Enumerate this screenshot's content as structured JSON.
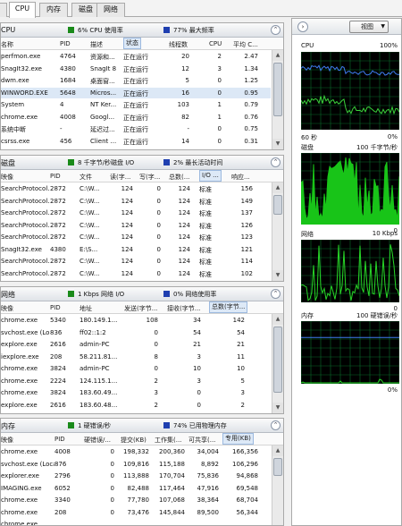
{
  "tabs": [
    "CPU",
    "内存",
    "磁盘",
    "网络"
  ],
  "cpu_panel": {
    "title": "CPU",
    "stat1": "6% CPU 使用率",
    "stat2": "77% 最大频率",
    "columns": [
      "名称",
      "PID",
      "描述",
      "状态",
      "线程数",
      "CPU",
      "平均 C..."
    ],
    "rows": [
      [
        "perfmon.exe",
        "4764",
        "资源和...",
        "正在运行",
        "20",
        "2",
        "2.47"
      ],
      [
        "SnagIt32.exe",
        "4380",
        "SnagIt 8",
        "正在运行",
        "12",
        "3",
        "1.34"
      ],
      [
        "dwm.exe",
        "1684",
        "桌面窗...",
        "正在运行",
        "5",
        "0",
        "1.25"
      ],
      [
        "WINWORD.EXE",
        "5648",
        "Micros...",
        "正在运行",
        "16",
        "0",
        "0.95"
      ],
      [
        "System",
        "4",
        "NT Ker...",
        "正在运行",
        "103",
        "1",
        "0.79"
      ],
      [
        "chrome.exe",
        "4008",
        "Googl...",
        "正在运行",
        "82",
        "1",
        "0.76"
      ],
      [
        "系统中断",
        "-",
        "延迟过...",
        "正在运行",
        "-",
        "0",
        "0.75"
      ],
      [
        "csrss.exe",
        "456",
        "Client ...",
        "正在运行",
        "14",
        "0",
        "0.31"
      ]
    ]
  },
  "disk_panel": {
    "title": "磁盘",
    "stat1": "8 千字节/秒磁盘 I/O",
    "stat2": "2% 最长活动时间",
    "columns": [
      "映像",
      "PID",
      "文件",
      "读(字...",
      "写(字...",
      "总数(...",
      "I/O ...",
      "响应..."
    ],
    "rows": [
      [
        "SearchProtocol...",
        "2872",
        "C:\\W...",
        "124",
        "0",
        "124",
        "标准",
        "156"
      ],
      [
        "SearchProtocol...",
        "2872",
        "C:\\W...",
        "124",
        "0",
        "124",
        "标准",
        "149"
      ],
      [
        "SearchProtocol...",
        "2872",
        "C:\\W...",
        "124",
        "0",
        "124",
        "标准",
        "137"
      ],
      [
        "SearchProtocol...",
        "2872",
        "C:\\W...",
        "124",
        "0",
        "124",
        "标准",
        "126"
      ],
      [
        "SearchProtocol...",
        "2872",
        "C:\\W...",
        "124",
        "0",
        "124",
        "标准",
        "123"
      ],
      [
        "SnagIt32.exe",
        "4380",
        "E:\\S...",
        "124",
        "0",
        "124",
        "标准",
        "121"
      ],
      [
        "SearchProtocol...",
        "2872",
        "C:\\W...",
        "124",
        "0",
        "124",
        "标准",
        "114"
      ],
      [
        "SearchProtocol...",
        "2872",
        "C:\\W...",
        "124",
        "0",
        "124",
        "标准",
        "102"
      ]
    ]
  },
  "net_panel": {
    "title": "网络",
    "stat1": "1 Kbps 网络 I/O",
    "stat2": "0% 网络使用率",
    "columns": [
      "映像",
      "PID",
      "地址",
      "发送(字节...",
      "接收(字节...",
      "总数(字节..."
    ],
    "rows": [
      [
        "chrome.exe",
        "5340",
        "180.149.1...",
        "108",
        "34",
        "142"
      ],
      [
        "svchost.exe (Lo...",
        "836",
        "ff02::1:2",
        "0",
        "54",
        "54"
      ],
      [
        "explore.exe",
        "2616",
        "admin-PC",
        "0",
        "21",
        "21"
      ],
      [
        "iexplore.exe",
        "208",
        "58.211.81...",
        "8",
        "3",
        "11"
      ],
      [
        "chrome.exe",
        "3824",
        "admin-PC",
        "0",
        "10",
        "10"
      ],
      [
        "chrome.exe",
        "2224",
        "124.115.1...",
        "2",
        "3",
        "5"
      ],
      [
        "chrome.exe",
        "3824",
        "183.60.49...",
        "3",
        "0",
        "3"
      ],
      [
        "explore.exe",
        "2616",
        "183.60.48...",
        "2",
        "0",
        "2"
      ]
    ]
  },
  "mem_panel": {
    "title": "内存",
    "stat1": "1 硬错误/秒",
    "stat2": "74% 已用物理内存",
    "columns": [
      "映像",
      "PID",
      "硬错误/...",
      "提交(KB)",
      "工作集(...",
      "可共享(...",
      "专用(KB)"
    ],
    "rows": [
      [
        "chrome.exe",
        "4008",
        "0",
        "198,332",
        "200,360",
        "34,004",
        "166,356"
      ],
      [
        "svchost.exe (Loca...",
        "876",
        "0",
        "109,816",
        "115,188",
        "8,892",
        "106,296"
      ],
      [
        "explorer.exe",
        "2796",
        "0",
        "113,888",
        "170,704",
        "75,836",
        "94,868"
      ],
      [
        "IMAGING.exe",
        "6052",
        "0",
        "82,488",
        "117,464",
        "47,916",
        "69,548"
      ],
      [
        "chrome.exe",
        "3340",
        "0",
        "77,780",
        "107,068",
        "38,364",
        "68,704"
      ],
      [
        "chrome.exe",
        "208",
        "0",
        "73,476",
        "145,844",
        "89,500",
        "56,344"
      ],
      [
        "chrome.exe",
        "...",
        "...",
        "...",
        "...",
        "...",
        "..."
      ]
    ]
  },
  "graph_pane": {
    "view_label": "视图",
    "cpu": {
      "label": "CPU",
      "right": "100%",
      "left_bottom": "60 秒",
      "right_bottom": "0%"
    },
    "disk": {
      "label": "磁盘",
      "right": "100 千字节/秒",
      "right_bottom": "0"
    },
    "net": {
      "label": "网络",
      "right": "10 Kbps",
      "right_bottom": "0"
    },
    "mem": {
      "label": "内存",
      "right": "100 硬错误/秒",
      "right_bottom": "0%"
    }
  },
  "colors": {
    "graph_bg": "#000000",
    "grid": "#0a6a2a",
    "cpu_line_green": "#3ad13a",
    "cpu_line_blue": "#3f7cf0",
    "disk_fill": "#18c418",
    "net_line": "#27d627",
    "mem_line": "#3f7cf0"
  }
}
